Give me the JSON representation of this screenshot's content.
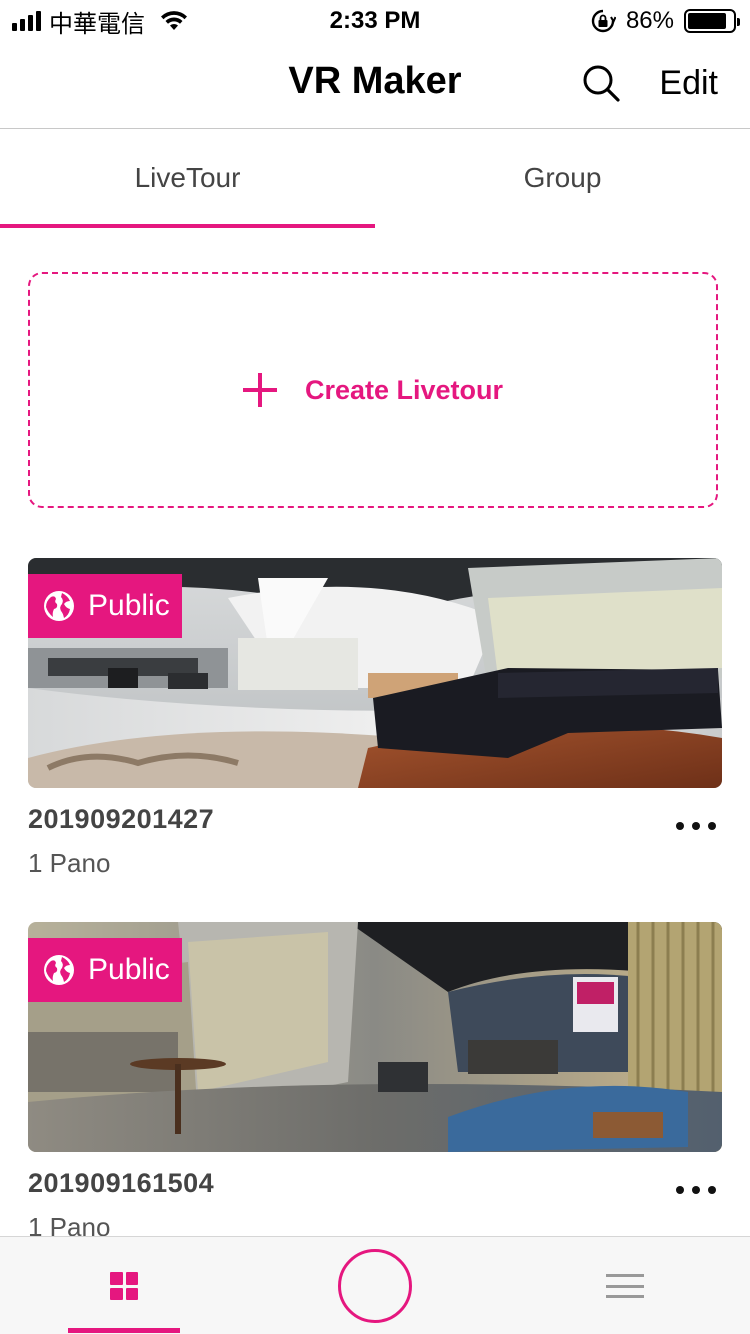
{
  "status_bar": {
    "carrier": "中華電信",
    "time": "2:33 PM",
    "battery_percent_label": "86%",
    "battery_level": 0.86
  },
  "nav": {
    "title": "VR Maker",
    "search_icon": "search-icon",
    "edit_label": "Edit"
  },
  "tabs": [
    {
      "label": "LiveTour",
      "active": true
    },
    {
      "label": "Group",
      "active": false
    }
  ],
  "create": {
    "icon": "plus-icon",
    "label": "Create Livetour"
  },
  "livetours": [
    {
      "badge": "Public",
      "badge_icon": "globe-icon",
      "title": "201909201427",
      "subtitle": "1 Pano",
      "more_icon": "more-icon"
    },
    {
      "badge": "Public",
      "badge_icon": "globe-icon",
      "title": "201909161504",
      "subtitle": "1 Pano",
      "more_icon": "more-icon"
    }
  ],
  "tab_bar": {
    "items": [
      {
        "icon": "grid-icon",
        "active": true
      },
      {
        "icon": "capture-icon",
        "active": false
      },
      {
        "icon": "menu-icon",
        "active": false
      }
    ]
  },
  "colors": {
    "accent": "#e5177f",
    "text_dark": "#111111",
    "text_muted": "#555555"
  }
}
